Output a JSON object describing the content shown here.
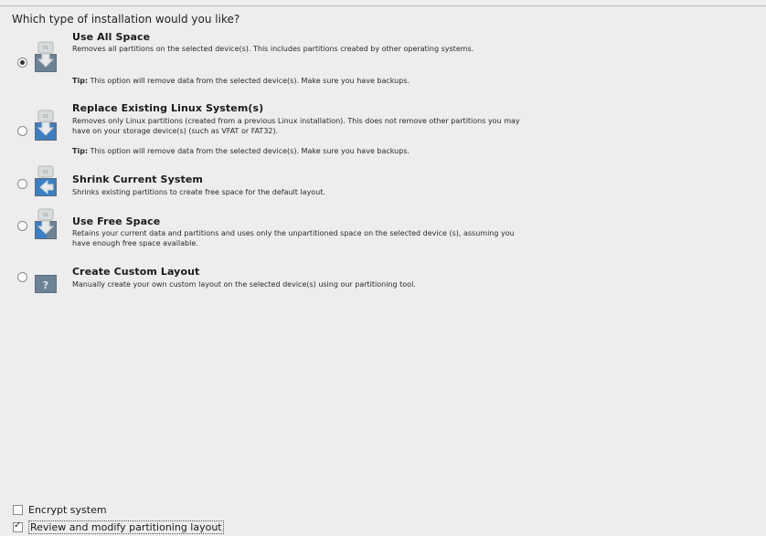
{
  "question": "Which type of installation would you like?",
  "options": [
    {
      "title": "Use All Space",
      "description": "Removes all partitions on the selected device(s).  This includes partitions created by other operating systems.",
      "tip_label": "Tip:",
      "tip_text": " This option will remove data from the selected device(s).  Make sure you have backups.",
      "selected": true,
      "icon": "disk-remove-all-icon"
    },
    {
      "title": "Replace Existing Linux System(s)",
      "description": "Removes only Linux partitions (created from a previous Linux installation).  This does not remove other partitions you may have on your storage device(s) (such as VFAT or FAT32).",
      "tip_label": "Tip:",
      "tip_text": " This option will remove data from the selected device(s).  Make sure you have backups.",
      "selected": false,
      "icon": "disk-replace-linux-icon"
    },
    {
      "title": "Shrink Current System",
      "description": "Shrinks existing partitions to create free space for the default layout.",
      "selected": false,
      "icon": "disk-shrink-icon"
    },
    {
      "title": "Use Free Space",
      "description": "Retains your current data and partitions and uses only the unpartitioned space on the selected device (s), assuming you have enough free space available.",
      "selected": false,
      "icon": "disk-free-space-icon"
    },
    {
      "title": "Create Custom Layout",
      "description": "Manually create your own custom layout on the selected device(s) using our partitioning tool.",
      "selected": false,
      "icon": "disk-custom-layout-icon"
    }
  ],
  "encrypt": {
    "label": "Encrypt system",
    "checked": false
  },
  "review": {
    "label": "Review and modify partitioning layout",
    "checked": true
  },
  "colors": {
    "background": "#ededed",
    "accent_blue": "#3a7fc4",
    "disk_gray": "#c8c8c8"
  }
}
